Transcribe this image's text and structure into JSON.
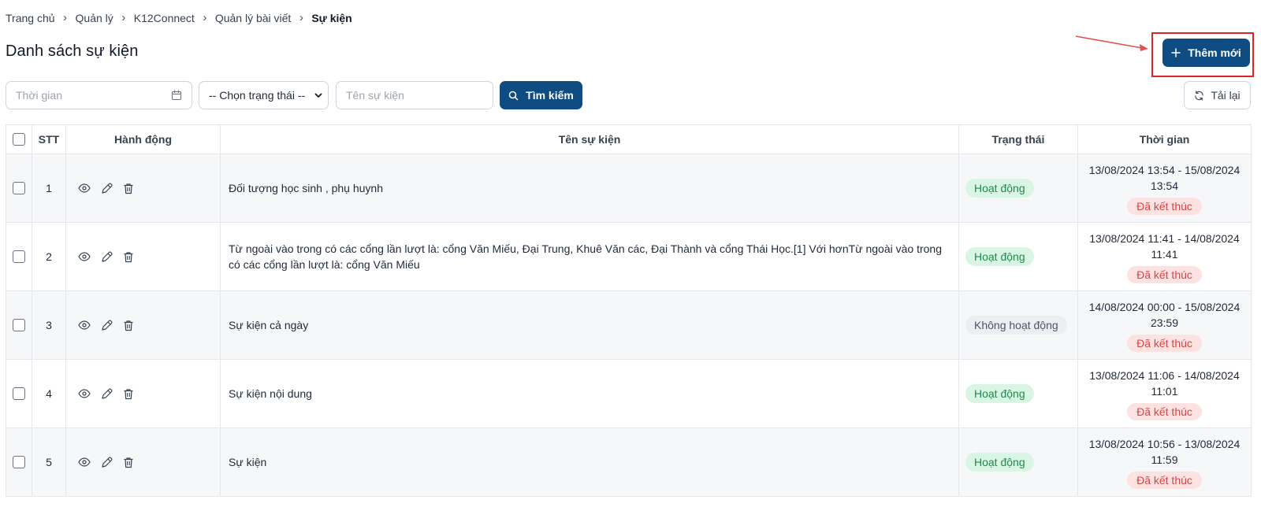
{
  "breadcrumb": [
    "Trang chủ",
    "Quản lý",
    "K12Connect",
    "Quản lý bài viết",
    "Sự kiện"
  ],
  "page_title": "Danh sách sự kiện",
  "add_button_label": "Thêm mới",
  "filters": {
    "time_placeholder": "Thời gian",
    "status_selected": "-- Chọn trạng thái --",
    "name_placeholder": "Tên sự kiện",
    "search_label": "Tìm kiếm",
    "reload_label": "Tải lại"
  },
  "table": {
    "headers": {
      "stt": "STT",
      "actions": "Hành động",
      "name": "Tên sự kiện",
      "status": "Trạng thái",
      "time": "Thời gian"
    },
    "rows": [
      {
        "stt": "1",
        "name": "Đối tượng học sinh , phụ huynh",
        "status": "Hoạt động",
        "status_type": "active",
        "time_line1": "13/08/2024 13:54 - 15/08/2024",
        "time_line2": "13:54",
        "end_label": "Đã kết thúc"
      },
      {
        "stt": "2",
        "name": "Từ ngoài vào trong có các cổng lần lượt là: cổng Văn Miếu, Đại Trung, Khuê Văn các, Đại Thành và cổng Thái Học.[1] Với hơnTừ ngoài vào trong có các cổng lần lượt là: cổng Văn Miếu",
        "status": "Hoạt động",
        "status_type": "active",
        "time_line1": "13/08/2024 11:41 - 14/08/2024",
        "time_line2": "11:41",
        "end_label": "Đã kết thúc"
      },
      {
        "stt": "3",
        "name": "Sự kiện cả ngày",
        "status": "Không hoạt động",
        "status_type": "inactive",
        "time_line1": "14/08/2024 00:00 - 15/08/2024",
        "time_line2": "23:59",
        "end_label": "Đã kết thúc"
      },
      {
        "stt": "4",
        "name": "Sự kiện nội dung",
        "status": "Hoạt động",
        "status_type": "active",
        "time_line1": "13/08/2024 11:06 - 14/08/2024",
        "time_line2": "11:01",
        "end_label": "Đã kết thúc"
      },
      {
        "stt": "5",
        "name": "Sự kiện",
        "status": "Hoạt động",
        "status_type": "active",
        "time_line1": "13/08/2024 10:56 - 13/08/2024",
        "time_line2": "11:59",
        "end_label": "Đã kết thúc"
      }
    ]
  },
  "colors": {
    "primary": "#0f4c81",
    "highlight": "#dc2626",
    "active_bg": "#d9f5e4",
    "active_text": "#1f8a4c",
    "ended_bg": "#fde2e2",
    "ended_text": "#d64545"
  }
}
